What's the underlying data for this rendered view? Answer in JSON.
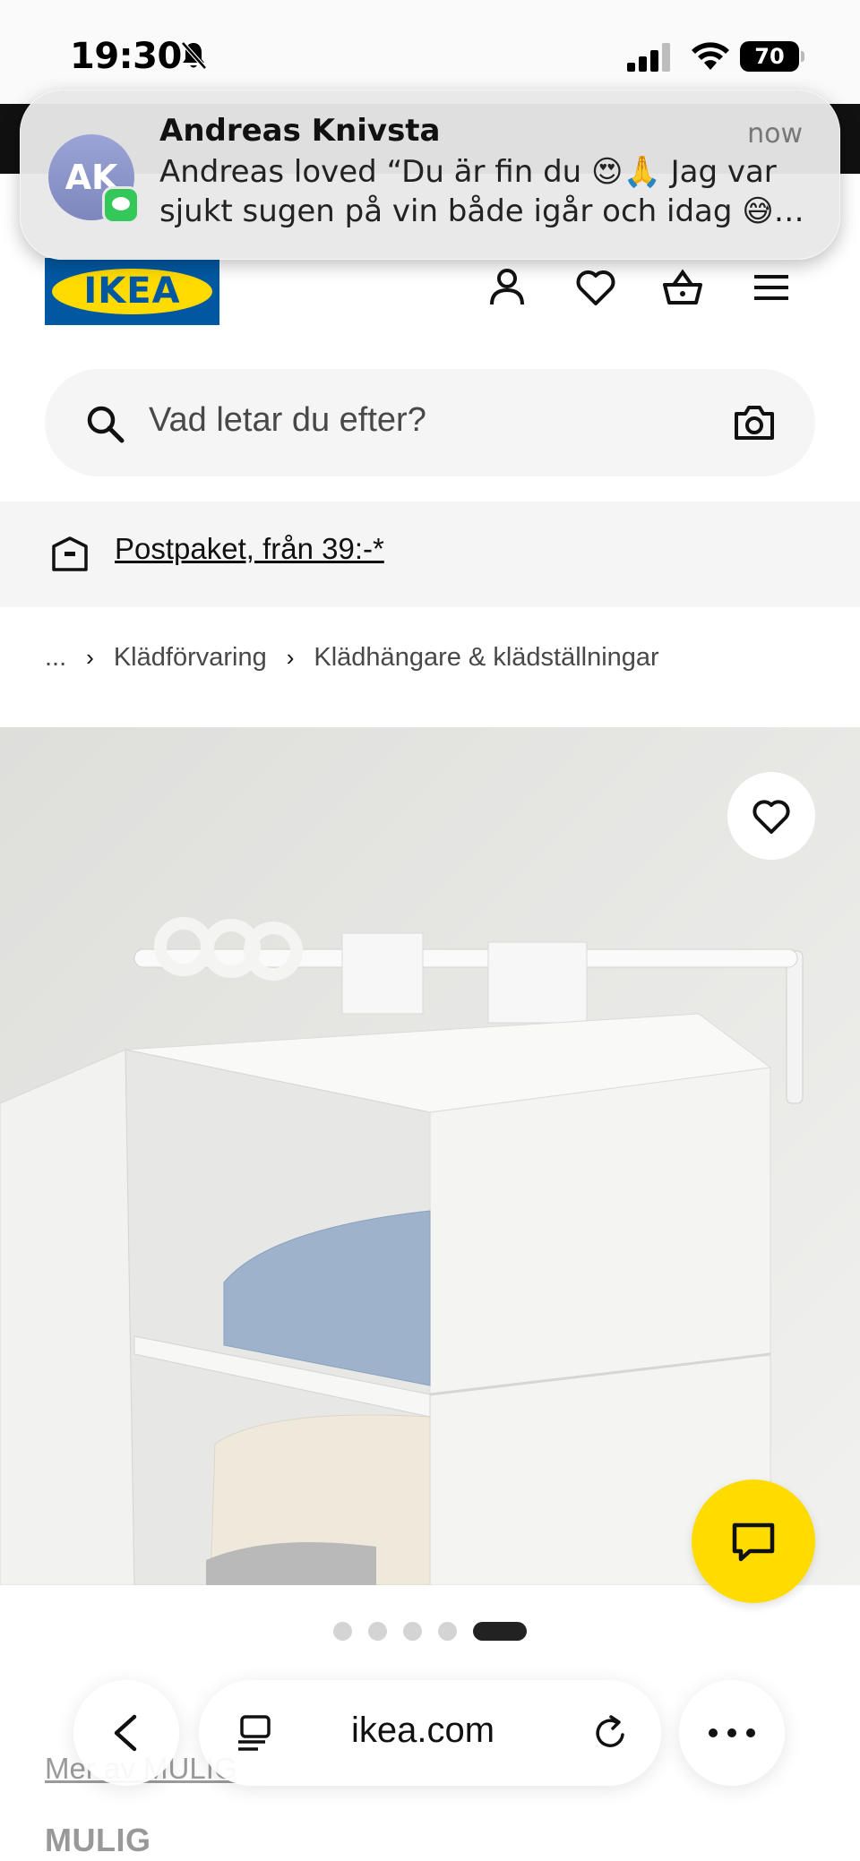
{
  "status_bar": {
    "time": "19:30",
    "battery": "70"
  },
  "notification": {
    "avatar_initials": "AK",
    "sender": "Andreas Knivsta",
    "time": "now",
    "message": "Andreas loved “Du är fin du 😍🙏 Jag var sjukt sugen på vin både igår och idag 😅…"
  },
  "header": {
    "logo_text": "IKEA",
    "icons": [
      "user-icon",
      "heart-icon",
      "basket-icon",
      "menu-icon"
    ]
  },
  "search": {
    "placeholder": "Vad letar du efter?"
  },
  "delivery": {
    "text": "Postpaket, från 39:-*"
  },
  "breadcrumb": {
    "ellipsis": "...",
    "items": [
      "Klädförvaring",
      "Klädhängare & klädställningar"
    ]
  },
  "carousel": {
    "total": 5,
    "active_index": 4
  },
  "product": {
    "more_link": "Mer av MULIG",
    "name": "MULIG"
  },
  "browser": {
    "url": "ikea.com"
  },
  "colors": {
    "ikea_blue": "#0058a3",
    "ikea_yellow": "#ffdb00",
    "message_green": "#34c759"
  }
}
